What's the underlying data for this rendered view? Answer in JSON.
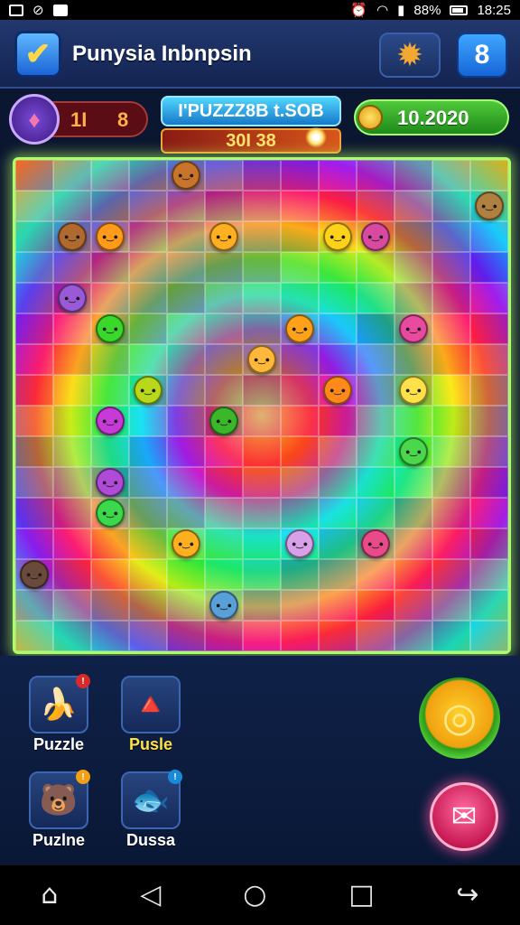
{
  "status_bar": {
    "icons_left": [
      "image-icon",
      "link-icon",
      "chat-icon"
    ],
    "battery_percent": "88%",
    "time": "18:25"
  },
  "header": {
    "title": "Punysia Inbnpsin",
    "level_badge": "8",
    "accent": "#1c64d6"
  },
  "stats": {
    "lives_a": "1I",
    "lives_b": "8",
    "score_title": "I'PUZZZ8B t.SOB",
    "score_value": "30I 38",
    "coins": "10.2020"
  },
  "board": {
    "critters": [
      {
        "face": "●‿●",
        "color": "#c8742a",
        "row": 0,
        "col": 4
      },
      {
        "face": "●‿●",
        "color": "#b06a30",
        "row": 2,
        "col": 1
      },
      {
        "face": "●‿●",
        "color": "#ff9a1a",
        "row": 2,
        "col": 2
      },
      {
        "face": "●‿●",
        "color": "#ffb020",
        "row": 2,
        "col": 5
      },
      {
        "face": "●‿●",
        "color": "#ffd21a",
        "row": 2,
        "col": 8
      },
      {
        "face": "●‿●",
        "color": "#d84aa0",
        "row": 2,
        "col": 9
      },
      {
        "face": "●‿●",
        "color": "#b08040",
        "row": 1,
        "col": 12
      },
      {
        "face": "●‿●",
        "color": "#9a5ad8",
        "row": 4,
        "col": 1
      },
      {
        "face": "●‿●",
        "color": "#3ad82a",
        "row": 5,
        "col": 2
      },
      {
        "face": "●‿●",
        "color": "#ffa21a",
        "row": 5,
        "col": 7
      },
      {
        "face": "●‿●",
        "color": "#e84aa0",
        "row": 5,
        "col": 10
      },
      {
        "face": "●‿●",
        "color": "#ffb83a",
        "row": 6,
        "col": 6
      },
      {
        "face": "●‿●",
        "color": "#b8d81a",
        "row": 7,
        "col": 3
      },
      {
        "face": "●‿●",
        "color": "#ff8a1a",
        "row": 7,
        "col": 8
      },
      {
        "face": "●‿●",
        "color": "#ffe24a",
        "row": 7,
        "col": 10
      },
      {
        "face": "●‿●",
        "color": "#c83ad8",
        "row": 8,
        "col": 2
      },
      {
        "face": "●‿●",
        "color": "#3ab82a",
        "row": 8,
        "col": 5
      },
      {
        "face": "●‿●",
        "color": "#4ad84a",
        "row": 9,
        "col": 10
      },
      {
        "face": "●‿●",
        "color": "#b04ad8",
        "row": 10,
        "col": 2
      },
      {
        "face": "●‿●",
        "color": "#3ad84a",
        "row": 11,
        "col": 2
      },
      {
        "face": "●‿●",
        "color": "#ffb020",
        "row": 12,
        "col": 4
      },
      {
        "face": "●‿●",
        "color": "#d8a0e8",
        "row": 12,
        "col": 7
      },
      {
        "face": "●‿●",
        "color": "#e84a8a",
        "row": 12,
        "col": 9
      },
      {
        "face": "●‿●",
        "color": "#6a4a3a",
        "row": 13,
        "col": 0
      },
      {
        "face": "●‿●",
        "color": "#5aa0d8",
        "row": 14,
        "col": 5
      }
    ]
  },
  "inventory": [
    {
      "label": "Puzzle",
      "art": "🍌",
      "badge_color": "#d82a2a",
      "label_color": "#ffffff"
    },
    {
      "label": "Pusle",
      "art": "🔺",
      "badge_color": "#1a8ad8",
      "label_color": "#ffe24a"
    },
    {
      "label": "Puzlne",
      "art": "🐻",
      "badge_color": "#f0a010",
      "label_color": "#ffffff"
    },
    {
      "label": "Dussa",
      "art": "🐟",
      "badge_color": "#1a8ad8",
      "label_color": "#ffffff"
    }
  ],
  "actions": {
    "gold_button_icon": "coin-ring-icon",
    "pink_button_icon": "envelope-icon"
  },
  "navbar": {
    "icons": [
      "home-icon",
      "back-icon",
      "circle-home-icon",
      "recents-icon",
      "share-icon"
    ]
  }
}
